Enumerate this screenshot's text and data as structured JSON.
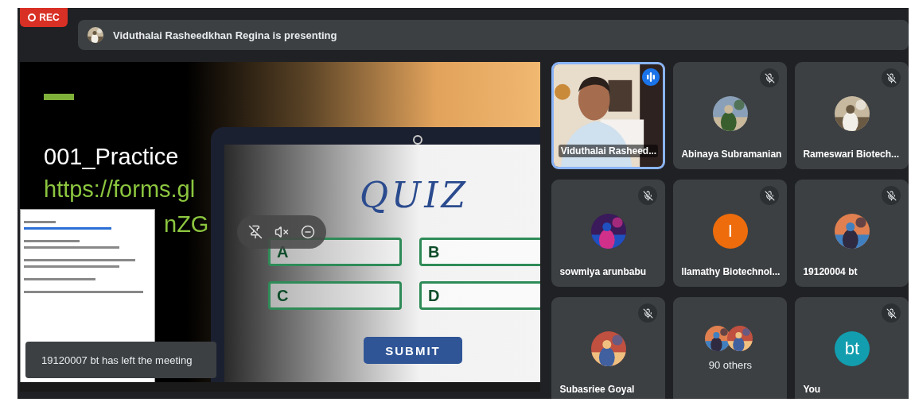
{
  "recording": {
    "label": "REC"
  },
  "presenting_banner": {
    "text": "Viduthalai Rasheedkhan Regina is presenting"
  },
  "shared_screen": {
    "slide": {
      "title": "001_Practice",
      "link_lines": [
        "https://forms.gl",
        "nZG"
      ]
    },
    "quiz": {
      "title": "QUIZ",
      "options": [
        "A",
        "B",
        "C",
        "D"
      ],
      "submit": "SUBMIT"
    },
    "notification": "19120007 bt has left the meeting"
  },
  "participants": [
    {
      "kind": "video",
      "name": "Viduthalai Rasheed...",
      "muted": false,
      "speaking": true
    },
    {
      "name": "Abinaya Subramanian",
      "muted": true,
      "speaking": false
    },
    {
      "name": "Rameswari Biotech...",
      "muted": true,
      "speaking": false
    },
    {
      "name": "sowmiya arunbabu",
      "muted": true,
      "speaking": false
    },
    {
      "kind": "initial",
      "name": "Ilamathy Biotechnol...",
      "initial": "I",
      "color": "#ee6c0c",
      "muted": true,
      "speaking": false
    },
    {
      "name": "19120004 bt",
      "muted": true,
      "speaking": false
    },
    {
      "name": "Subasriee Goyal",
      "muted": true,
      "speaking": false
    },
    {
      "kind": "others",
      "name": "90 others",
      "muted": false,
      "speaking": false
    },
    {
      "kind": "initial",
      "name": "You",
      "initial": "bt",
      "color": "#129eaf",
      "muted": true,
      "speaking": false
    }
  ]
}
